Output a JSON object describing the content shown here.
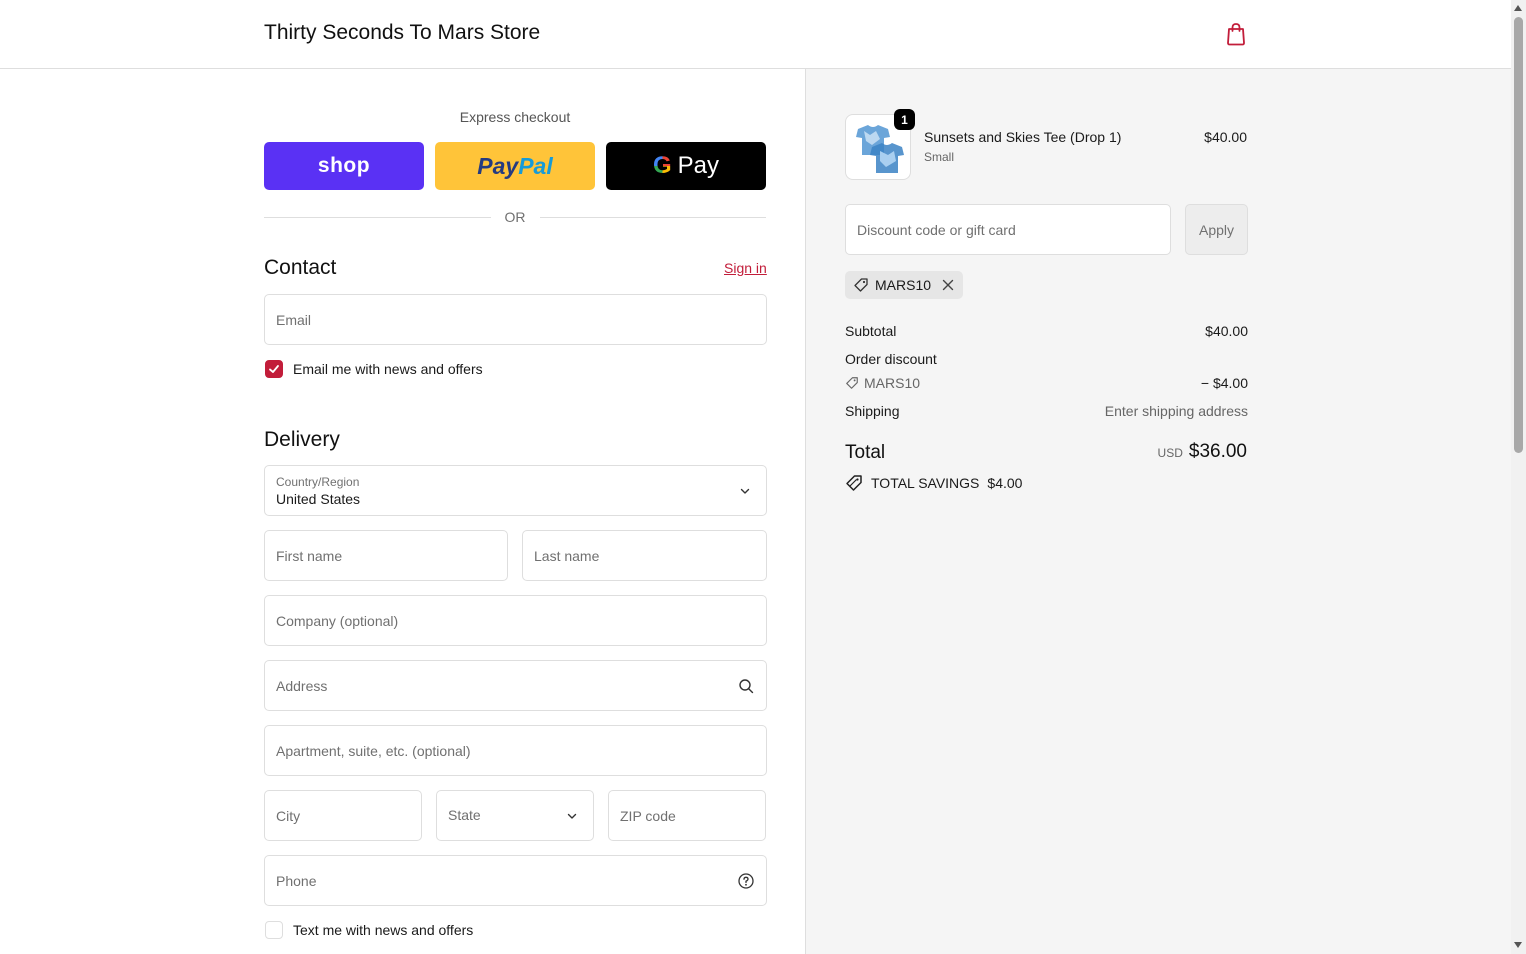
{
  "header": {
    "store_name": "Thirty Seconds To Mars Store",
    "cart_icon": "shopping-bag-icon"
  },
  "express": {
    "label": "Express checkout",
    "shop_label": "shop",
    "paypal_label_1": "Pay",
    "paypal_label_2": "Pal",
    "gpay_g": "G",
    "gpay_label": "Pay",
    "or_label": "OR"
  },
  "contact": {
    "title": "Contact",
    "signin_label": "Sign in",
    "email_placeholder": "Email",
    "news_checkbox_label": "Email me with news and offers",
    "news_checked": true
  },
  "delivery": {
    "title": "Delivery",
    "country_label": "Country/Region",
    "country_value": "United States",
    "first_name_placeholder": "First name",
    "last_name_placeholder": "Last name",
    "company_placeholder": "Company (optional)",
    "address_placeholder": "Address",
    "apartment_placeholder": "Apartment, suite, etc. (optional)",
    "city_placeholder": "City",
    "state_placeholder": "State",
    "zip_placeholder": "ZIP code",
    "phone_placeholder": "Phone",
    "sms_checkbox_label": "Text me with news and offers",
    "sms_checked": false
  },
  "order": {
    "product_name": "Sunsets and Skies Tee (Drop 1)",
    "product_variant": "Small",
    "product_price": "$40.00",
    "quantity": "1",
    "discount_placeholder": "Discount code or gift card",
    "apply_label": "Apply",
    "applied_code": "MARS10",
    "subtotal_label": "Subtotal",
    "subtotal_value": "$40.00",
    "order_discount_label": "Order discount",
    "discount_code": "MARS10",
    "discount_value": "− $4.00",
    "shipping_label": "Shipping",
    "shipping_value": "Enter shipping address",
    "total_label": "Total",
    "total_currency": "USD",
    "total_value": "$36.00",
    "savings_label": "TOTAL SAVINGS",
    "savings_value": "$4.00"
  },
  "colors": {
    "accent": "#c21d3a",
    "shop_purple": "#5a31f4",
    "paypal_yellow": "#ffc439",
    "sidebar_bg": "#f5f5f5"
  }
}
